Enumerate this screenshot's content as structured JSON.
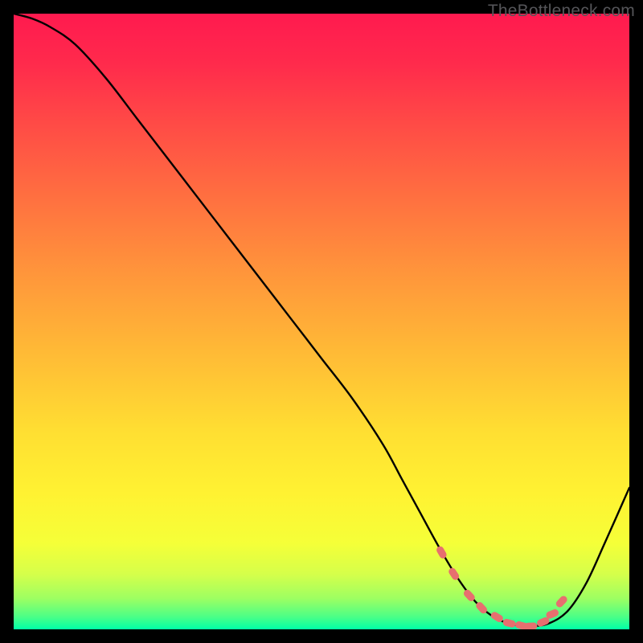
{
  "watermark": "TheBottleneck.com",
  "gradient_stops": [
    {
      "offset": 0.0,
      "color": "#ff1a4f"
    },
    {
      "offset": 0.08,
      "color": "#ff2a4c"
    },
    {
      "offset": 0.18,
      "color": "#ff4b46"
    },
    {
      "offset": 0.3,
      "color": "#ff7040"
    },
    {
      "offset": 0.42,
      "color": "#ff953b"
    },
    {
      "offset": 0.55,
      "color": "#ffba36"
    },
    {
      "offset": 0.68,
      "color": "#ffdf32"
    },
    {
      "offset": 0.78,
      "color": "#fff232"
    },
    {
      "offset": 0.86,
      "color": "#f5ff38"
    },
    {
      "offset": 0.91,
      "color": "#d6ff4a"
    },
    {
      "offset": 0.95,
      "color": "#9dff62"
    },
    {
      "offset": 0.98,
      "color": "#4aff87"
    },
    {
      "offset": 1.0,
      "color": "#00ffa8"
    }
  ],
  "marker_color": "#e76f6f",
  "chart_data": {
    "type": "line",
    "title": "",
    "xlabel": "",
    "ylabel": "",
    "xlim": [
      0,
      100
    ],
    "ylim": [
      0,
      100
    ],
    "series": [
      {
        "name": "bottleneck-curve",
        "x": [
          0,
          3,
          6,
          10,
          15,
          20,
          25,
          30,
          35,
          40,
          45,
          50,
          55,
          60,
          63,
          66,
          69,
          72,
          75,
          78,
          81,
          84,
          87,
          90,
          93,
          96,
          100
        ],
        "y": [
          100,
          99.2,
          97.8,
          95.0,
          89.5,
          83.0,
          76.5,
          70.0,
          63.5,
          57.0,
          50.5,
          44.0,
          37.5,
          30.0,
          24.5,
          19.0,
          13.5,
          8.5,
          4.5,
          2.0,
          0.8,
          0.5,
          1.0,
          3.0,
          7.5,
          14.0,
          23.0
        ]
      }
    ],
    "markers": {
      "name": "optimal-range",
      "x": [
        69.5,
        71.5,
        74.0,
        76.0,
        78.5,
        80.5,
        82.5,
        84.0,
        86.0,
        87.5,
        89.0
      ],
      "y": [
        12.5,
        9.0,
        5.5,
        3.5,
        2.0,
        1.0,
        0.6,
        0.5,
        1.2,
        2.5,
        4.5
      ]
    }
  }
}
